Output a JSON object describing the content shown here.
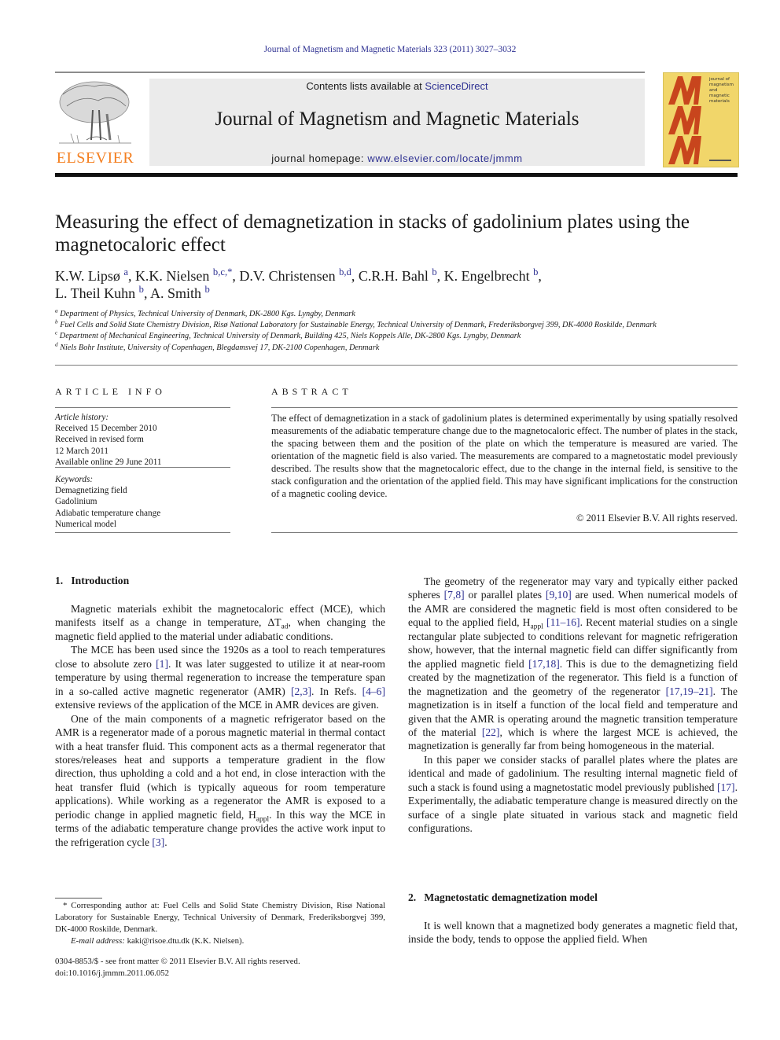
{
  "journal_citation": "Journal of Magnetism and Magnetic Materials 323 (2011) 3027–3032",
  "header": {
    "publisher_logo_text": "ELSEVIER",
    "contents_prefix": "Contents lists available at ",
    "contents_link": "ScienceDirect",
    "journal_title": "Journal of Magnetism and Magnetic Materials",
    "homepage_prefix": "journal homepage: ",
    "homepage_link": "www.elsevier.com/locate/jmmm",
    "cover_text": "journal of magnetism and magnetic materials",
    "cover_letters": [
      "M",
      "M",
      "M"
    ],
    "colors": {
      "elsevier_orange": "#f47f20",
      "link_blue": "#2e3192",
      "cover_yellow": "#f1d66a",
      "cover_red": "#c8451d",
      "banner_gray": "#ebebeb"
    }
  },
  "article": {
    "title": "Measuring the effect of demagnetization in stacks of gadolinium plates using the magnetocaloric effect",
    "authors": [
      {
        "name": "K.W. Lipsø",
        "aff": "a",
        "sep": ", "
      },
      {
        "name": "K.K. Nielsen",
        "aff": "b,c,*",
        "sep": ", "
      },
      {
        "name": "D.V. Christensen",
        "aff": "b,d",
        "sep": ", "
      },
      {
        "name": "C.R.H. Bahl",
        "aff": "b",
        "sep": ", "
      },
      {
        "name": "K. Engelbrecht",
        "aff": "b",
        "sep": ","
      },
      {
        "name": "L. Theil Kuhn",
        "aff": "b",
        "sep": ", "
      },
      {
        "name": "A. Smith",
        "aff": "b",
        "sep": ""
      }
    ],
    "affiliations": [
      {
        "key": "a",
        "text": "Department of Physics, Technical University of Denmark, DK-2800 Kgs. Lyngby, Denmark"
      },
      {
        "key": "b",
        "text": "Fuel Cells and Solid State Chemistry Division, Risø National Laboratory for Sustainable Energy, Technical University of Denmark, Frederiksborgvej 399, DK-4000 Roskilde, Denmark"
      },
      {
        "key": "c",
        "text": "Department of Mechanical Engineering, Technical University of Denmark, Building 425, Niels Koppels Alle, DK-2800 Kgs. Lyngby, Denmark"
      },
      {
        "key": "d",
        "text": "Niels Bohr Institute, University of Copenhagen, Blegdamsvej 17, DK-2100 Copenhagen, Denmark"
      }
    ]
  },
  "article_info": {
    "label": "ARTICLE INFO",
    "history_label": "Article history:",
    "history": [
      "Received 15 December 2010",
      "Received in revised form",
      "12 March 2011",
      "Available online 29 June 2011"
    ],
    "keywords_label": "Keywords:",
    "keywords": [
      "Demagnetizing field",
      "Gadolinium",
      "Adiabatic temperature change",
      "Numerical model"
    ]
  },
  "abstract": {
    "label": "ABSTRACT",
    "text": "The effect of demagnetization in a stack of gadolinium plates is determined experimentally by using spatially resolved measurements of the adiabatic temperature change due to the magnetocaloric effect. The number of plates in the stack, the spacing between them and the position of the plate on which the temperature is measured are varied. The orientation of the magnetic field is also varied. The measurements are compared to a magnetostatic model previously described. The results show that the magnetocaloric effect, due to the change in the internal field, is sensitive to the stack configuration and the orientation of the applied field. This may have significant implications for the construction of a magnetic cooling device.",
    "copyright": "© 2011 Elsevier B.V. All rights reserved."
  },
  "sections": {
    "s1_heading": "1.   Introduction",
    "s1_p1": [
      "Magnetic materials exhibit the magnetocaloric effect (MCE), which manifests itself as a change in temperature, ΔT",
      "ad",
      ", when changing the magnetic field applied to the material under adiabatic conditions."
    ],
    "s1_p2": [
      "The MCE has been used since the 1920s as a tool to reach temperatures close to absolute zero ",
      "[1]",
      ". It was later suggested to utilize it at near-room temperature by using thermal regeneration to increase the temperature span in a so-called active magnetic regenerator (AMR) ",
      "[2,3]",
      ". In Refs. ",
      "[4–6]",
      " extensive reviews of the application of the MCE in AMR devices are given."
    ],
    "s1_p3": [
      "One of the main components of a magnetic refrigerator based on the AMR is a regenerator made of a porous magnetic material in thermal contact with a heat transfer fluid. This component acts as a thermal regenerator that stores/releases heat and supports a temperature gradient in the flow direction, thus upholding a cold and a hot end, in close interaction with the heat transfer fluid (which is typically aqueous for room temperature applications). While working as a regenerator the AMR is exposed to a periodic change in applied magnetic field, H",
      "appl",
      ". In this way the MCE in terms of the adiabatic temperature change provides the active work input to the refrigeration cycle ",
      "[3]",
      "."
    ],
    "s1_p4": [
      "The geometry of the regenerator may vary and typically either packed spheres ",
      "[7,8]",
      " or parallel plates ",
      "[9,10]",
      " are used. When numerical models of the AMR are considered the magnetic field is most often considered to be equal to the applied field, H",
      "appl",
      " ",
      "[11–16]",
      ". Recent material studies on a single rectangular plate subjected to conditions relevant for magnetic refrigeration show, however, that the internal magnetic field can differ significantly from the applied magnetic field ",
      "[17,18]",
      ". This is due to the demagnetizing field created by the magnetization of the regenerator. This field is a function of the magnetization and the geometry of the regenerator ",
      "[17,19–21]",
      ". The magnetization is in itself a function of the local field and temperature and given that the AMR is operating around the magnetic transition temperature of the material ",
      "[22]",
      ", which is where the largest MCE is achieved, the magnetization is generally far from being homogeneous in the material."
    ],
    "s1_p5": [
      "In this paper we consider stacks of parallel plates where the plates are identical and made of gadolinium. The resulting internal magnetic field of such a stack is found using a magnetostatic model previously published ",
      "[17]",
      ". Experimentally, the adiabatic temperature change is measured directly on the surface of a single plate situated in various stack and magnetic field configurations."
    ],
    "s2_heading": "2.   Magnetostatic demagnetization model",
    "s2_p1": "It is well known that a magnetized body generates a magnetic field that, inside the body, tends to oppose the applied field. When"
  },
  "footnote": {
    "corresponding": "* Corresponding author at: Fuel Cells and Solid State Chemistry Division, Risø National Laboratory for Sustainable Energy, Technical University of Denmark, Frederiksborgvej 399, DK-4000 Roskilde, Denmark.",
    "email_label": "E-mail address:",
    "email": "kaki@risoe.dtu.dk",
    "email_suffix": " (K.K. Nielsen)."
  },
  "front_matter": {
    "issn_line": "0304-8853/$ - see front matter © 2011 Elsevier B.V. All rights reserved.",
    "doi": "doi:10.1016/j.jmmm.2011.06.052"
  }
}
